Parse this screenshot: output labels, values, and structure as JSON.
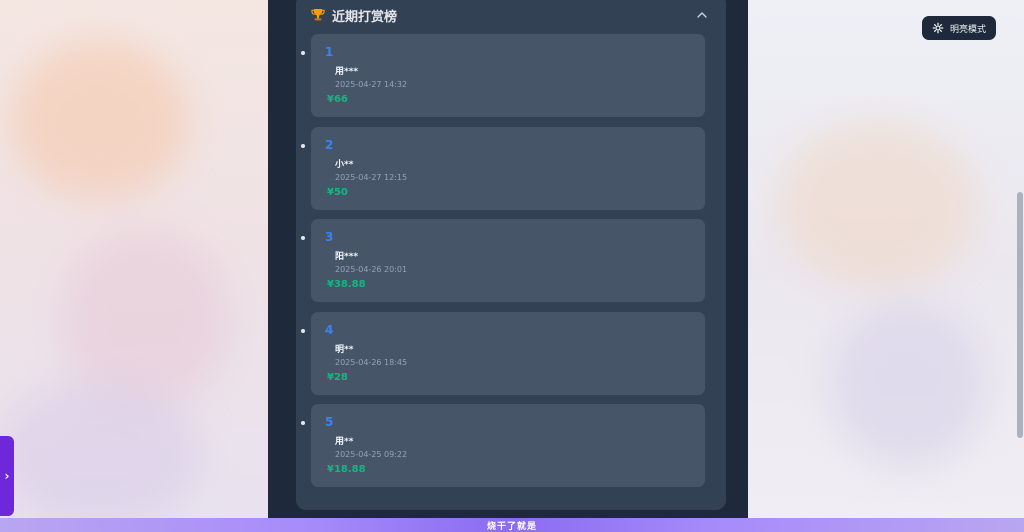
{
  "header": {
    "title": "近期打赏榜",
    "trophy_icon": "trophy-icon",
    "collapse_icon": "chevron-up-icon"
  },
  "mode_toggle": {
    "label": "明亮模式",
    "icon": "gear-icon"
  },
  "donations": [
    {
      "rank": "1",
      "name": "用***",
      "time": "2025-04-27 14:32",
      "amount": "¥66"
    },
    {
      "rank": "2",
      "name": "小**",
      "time": "2025-04-27 12:15",
      "amount": "¥50"
    },
    {
      "rank": "3",
      "name": "阳***",
      "time": "2025-04-26 20:01",
      "amount": "¥38.88"
    },
    {
      "rank": "4",
      "name": "明**",
      "time": "2025-04-26 18:45",
      "amount": "¥28"
    },
    {
      "rank": "5",
      "name": "用**",
      "time": "2025-04-25 09:22",
      "amount": "¥18.88"
    }
  ],
  "footer": {
    "text": "烧干了就是"
  },
  "colors": {
    "panel_bg": "#1e293b",
    "card_bg": "#334155",
    "item_bg": "#475569",
    "rank": "#3b82f6",
    "amount": "#10b981",
    "side_tab": "#6d28d9"
  },
  "side_tab": {
    "icon": "chevron-right-icon"
  }
}
